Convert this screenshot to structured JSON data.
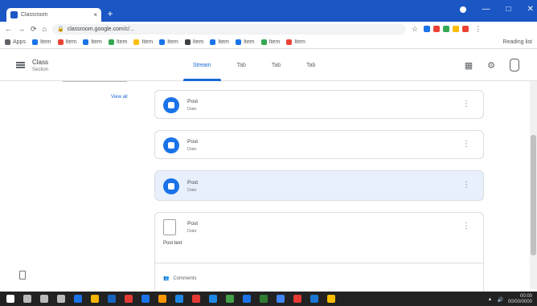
{
  "browser": {
    "tab_title": "Classroom",
    "tab_close": "×",
    "new_tab": "+",
    "window_controls": [
      "—",
      "□",
      "✕"
    ],
    "nav": [
      "←",
      "→",
      "⟳",
      "⌂"
    ],
    "url": "classroom.google.com/c/...",
    "star": "☆",
    "menu": "⋮",
    "bookmarks": [
      {
        "label": "Apps",
        "color": "#5f6368"
      },
      {
        "label": "Item",
        "color": "#1a73e8"
      },
      {
        "label": "Item",
        "color": "#ea4335"
      },
      {
        "label": "Item",
        "color": "#1a73e8"
      },
      {
        "label": "Item",
        "color": "#34a853"
      },
      {
        "label": "Item",
        "color": "#fbbc04"
      },
      {
        "label": "Item",
        "color": "#1a73e8"
      },
      {
        "label": "Item",
        "color": "#3c4043"
      },
      {
        "label": "Item",
        "color": "#1a73e8"
      },
      {
        "label": "Item",
        "color": "#1a73e8"
      },
      {
        "label": "Item",
        "color": "#34a853"
      },
      {
        "label": "Item",
        "color": "#ea4335"
      }
    ],
    "reading_list": "Reading list",
    "extension_colors": [
      "#1a73e8",
      "#ea4335",
      "#34a853",
      "#fbbc04",
      "#ea4335"
    ]
  },
  "app": {
    "class_name": "Class",
    "class_section": "Section",
    "tabs": [
      {
        "label": "Stream",
        "active": true
      },
      {
        "label": "Tab",
        "active": false
      },
      {
        "label": "Tab",
        "active": false
      },
      {
        "label": "Tab",
        "active": false
      }
    ],
    "icons": [
      "calendar-icon",
      "settings-icon"
    ]
  },
  "left": {
    "view_all": "View all"
  },
  "stream": [
    {
      "title": "Post",
      "date": "Date",
      "highlight": false
    },
    {
      "title": "Post",
      "date": "Date",
      "highlight": false
    },
    {
      "title": "Post",
      "date": "Date",
      "highlight": true
    },
    {
      "title": "Post",
      "date": "Date",
      "highlight": false,
      "body": "Post text",
      "comments": "Comments"
    }
  ],
  "taskbar": {
    "clock_time": "00:00",
    "clock_date": "00/00/0000",
    "icon_colors": [
      "#ffffff",
      "#bbbbbb",
      "#bbbbbb",
      "#bbbbbb",
      "#1a73e8",
      "#f4b400",
      "#1565c0",
      "#e53935",
      "#1a73e8",
      "#ff9800",
      "#1e88e5",
      "#e53935",
      "#1e88e5",
      "#43a047",
      "#1a73e8",
      "#2e7d32",
      "#4285f4",
      "#e53935",
      "#1976d2",
      "#fbbc04"
    ]
  },
  "colors": {
    "accent": "#1967d2",
    "titlebar": "#1a56c4",
    "card_highlight": "#e8f0fe"
  }
}
